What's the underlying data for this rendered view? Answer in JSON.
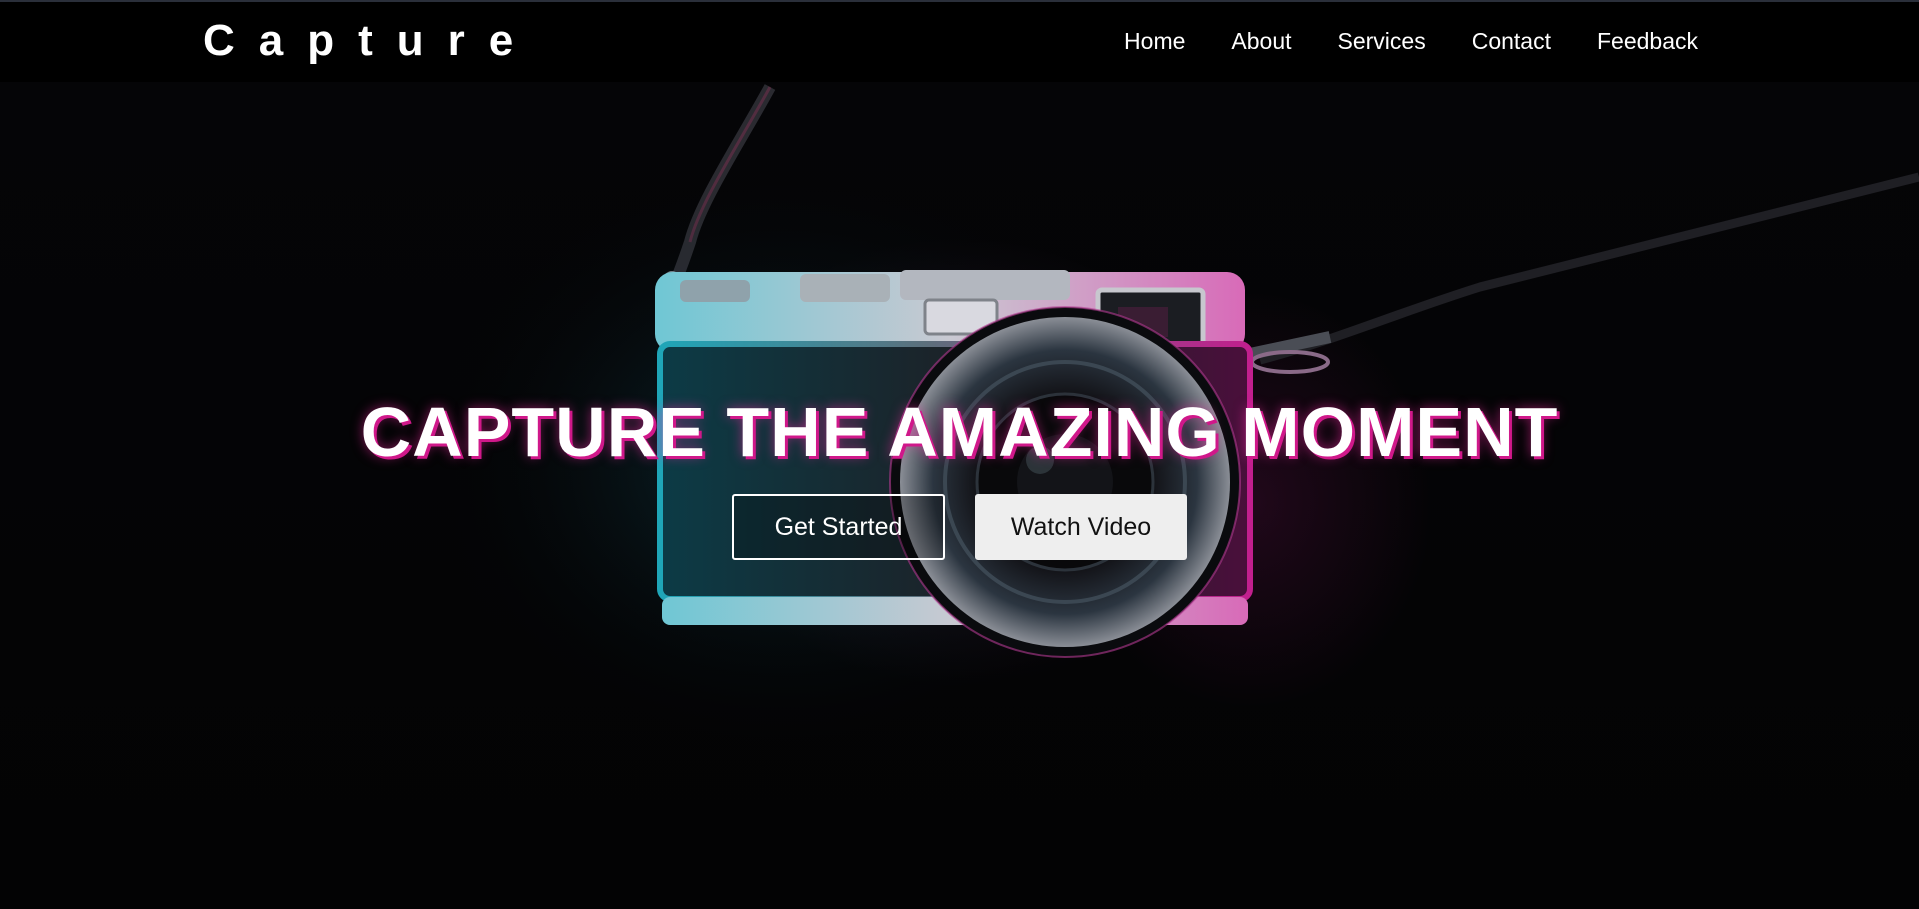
{
  "brand": {
    "name": "Capture"
  },
  "nav": {
    "items": [
      {
        "label": "Home"
      },
      {
        "label": "About"
      },
      {
        "label": "Services"
      },
      {
        "label": "Contact"
      },
      {
        "label": "Feedback"
      }
    ]
  },
  "hero": {
    "title": "CAPTURE THE AMAZING MOMENT",
    "primary_button": "Get Started",
    "secondary_button": "Watch Video",
    "background_image": "camera-photo"
  },
  "colors": {
    "navbar_bg": "#000000",
    "text": "#ffffff",
    "title_glow": "#d0188a",
    "secondary_button_bg": "#eeeeee"
  }
}
